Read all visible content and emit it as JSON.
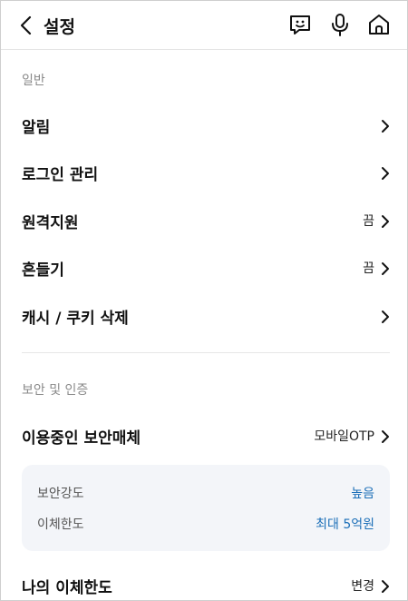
{
  "header": {
    "title": "설정",
    "icons": [
      "back-chevron-icon",
      "chat-face-icon",
      "microphone-icon",
      "home-icon"
    ]
  },
  "general": {
    "section_label": "일반",
    "items": [
      {
        "label": "알림",
        "value": ""
      },
      {
        "label": "로그인 관리",
        "value": ""
      },
      {
        "label": "원격지원",
        "value": "끔"
      },
      {
        "label": "흔들기",
        "value": "끔"
      },
      {
        "label": "캐시 / 쿠키 삭제",
        "value": ""
      }
    ]
  },
  "security": {
    "section_label": "보안 및 인증",
    "media_row": {
      "label": "이용중인 보안매체",
      "value": "모바일OTP"
    },
    "card": {
      "strength_label": "보안강도",
      "strength_value": "높음",
      "limit_label": "이체한도",
      "limit_value": "최대 5억원"
    },
    "my_limit_row": {
      "label": "나의 이체한도",
      "value": "변경"
    }
  },
  "colors": {
    "accent": "#1c6fb8",
    "card_bg": "#f3f5f9"
  }
}
